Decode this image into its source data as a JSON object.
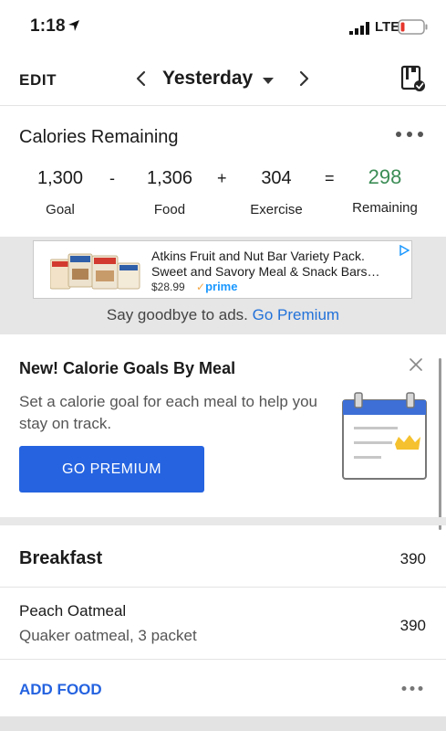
{
  "status_bar": {
    "time": "1:18",
    "network": "LTE"
  },
  "navbar": {
    "edit_label": "EDIT",
    "date_label": "Yesterday"
  },
  "calories": {
    "title": "Calories Remaining",
    "goal": {
      "value": "1,300",
      "label": "Goal"
    },
    "food": {
      "value": "1,306",
      "label": "Food"
    },
    "exercise": {
      "value": "304",
      "label": "Exercise"
    },
    "remaining": {
      "value": "298",
      "label": "Remaining"
    },
    "operators": {
      "minus": "-",
      "plus": "+",
      "equals": "="
    }
  },
  "ad": {
    "line1": "Atkins Fruit and Nut Bar Variety Pack.",
    "line2": "Sweet and Savory Meal & Snack Bars…",
    "price": "$28.99",
    "prime_label": "prime",
    "remove_text": "Say goodbye to ads.",
    "remove_link": "Go Premium"
  },
  "promo": {
    "title": "New! Calorie Goals By Meal",
    "body": "Set a calorie goal for each meal to help you stay on track.",
    "button_label": "GO PREMIUM"
  },
  "meal": {
    "title": "Breakfast",
    "calories": "390",
    "items": [
      {
        "name": "Peach Oatmeal",
        "description": "Quaker oatmeal, 3 packet",
        "calories": "390"
      }
    ],
    "add_food_label": "ADD FOOD"
  },
  "colors": {
    "accent_blue": "#2563e0",
    "remaining_green": "#3c8d56",
    "link_blue": "#2272d9"
  },
  "icons": [
    "location-arrow-icon",
    "signal-icon",
    "battery-low-icon",
    "chevron-left-icon",
    "chevron-right-icon",
    "caret-down-icon",
    "diary-check-icon",
    "more-dots-icon",
    "close-icon",
    "adchoices-icon",
    "calendar-crown-icon"
  ]
}
